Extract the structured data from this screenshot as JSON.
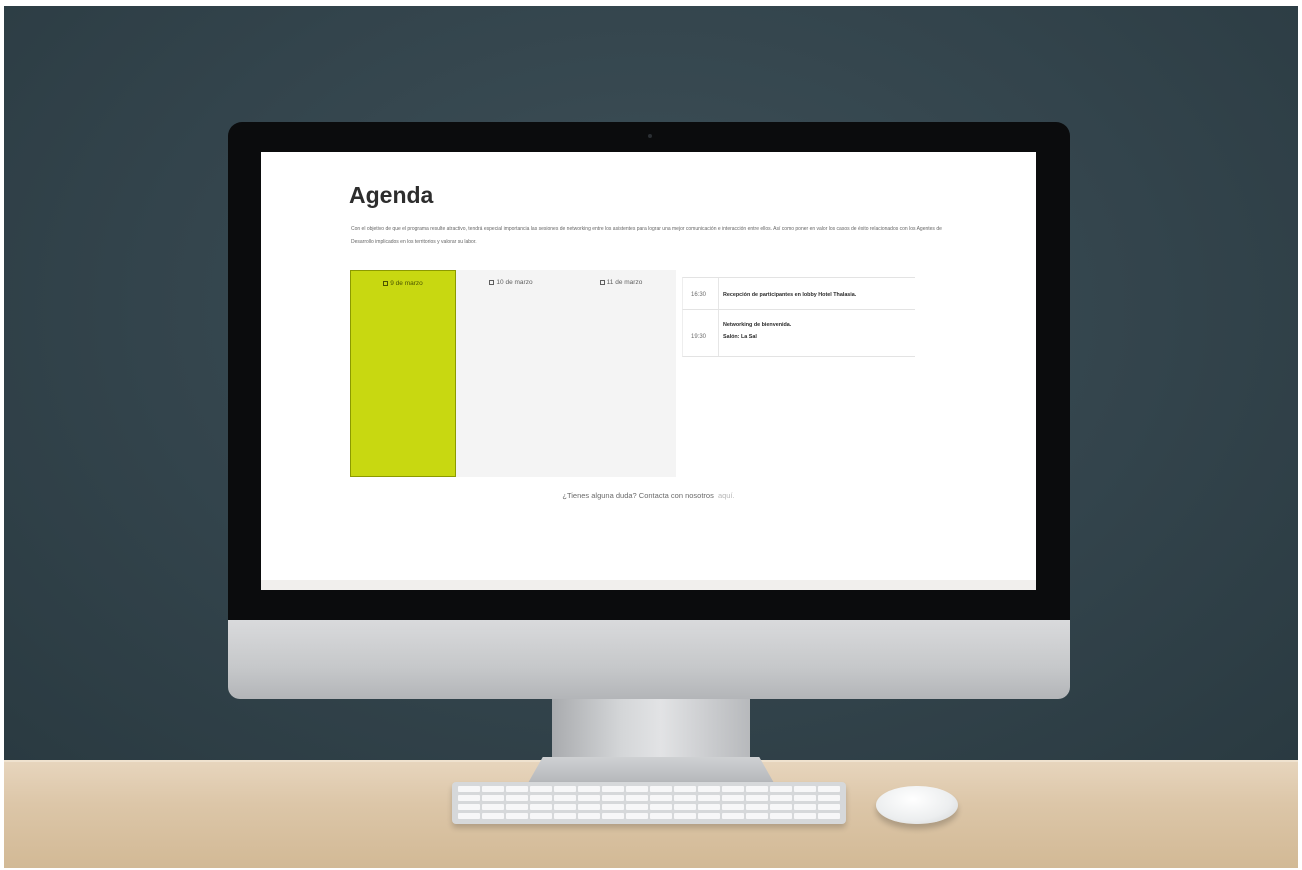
{
  "page": {
    "title": "Agenda",
    "intro": "Con el objetivo de que el programa resulte atractivo, tendrá especial importancia las sesiones de networking entre los asistentes para lograr una mejor comunicación e interacción entre ellos. Así como poner en valor los casos de éxito relacionados con los Agentes de Desarrollo implicados en los territorios y valorar su labor."
  },
  "tabs": [
    {
      "label": "9 de marzo",
      "active": true
    },
    {
      "label": "10 de marzo",
      "active": false
    },
    {
      "label": "11 de marzo",
      "active": false
    }
  ],
  "events": [
    {
      "time": "16:30",
      "title": "Recepción de participantes en lobby Hotel Thalasia.",
      "venue": ""
    },
    {
      "time": "19:30",
      "title": "Networking de bienvenida.",
      "venue": "Salón: La Sal"
    }
  ],
  "contact": {
    "text": "¿Tienes alguna duda? Contacta con nosotros",
    "link": "aquí."
  },
  "colors": {
    "accent": "#c8d811",
    "wall": "#33444c",
    "desk": "#dcc6a8"
  }
}
